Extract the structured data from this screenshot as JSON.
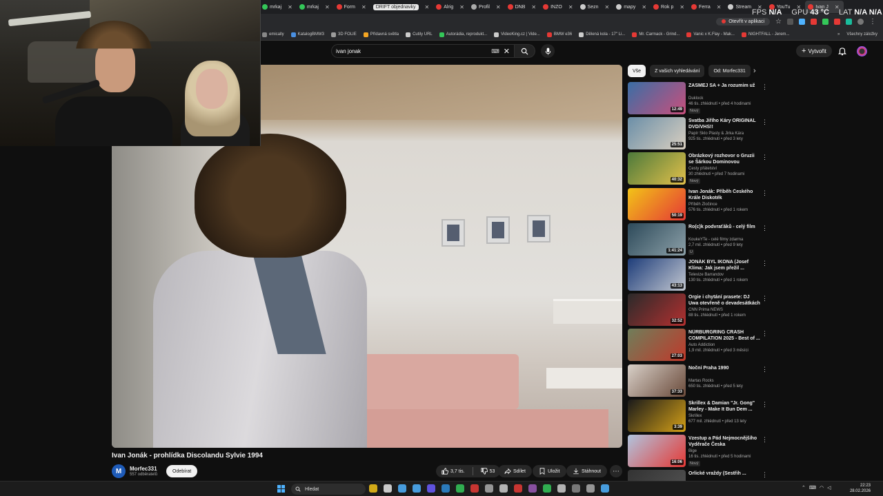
{
  "browser": {
    "tabs": [
      {
        "label": "mrkaj",
        "color": "#34c759"
      },
      {
        "label": "mrkaj",
        "color": "#34c759"
      },
      {
        "label": "Form",
        "color": "#e53935"
      },
      {
        "label": "DRIFT objednavky",
        "color": "#ffffff",
        "pill": true
      },
      {
        "label": "Alrig",
        "color": "#e53935"
      },
      {
        "label": "Profil",
        "color": "#aaaaaa"
      },
      {
        "label": "DNB",
        "color": "#e53935"
      },
      {
        "label": "INZO",
        "color": "#e53935"
      },
      {
        "label": "Sezn",
        "color": "#cccccc"
      },
      {
        "label": "mapy",
        "color": "#cccccc"
      },
      {
        "label": "Rok p",
        "color": "#e53935"
      },
      {
        "label": "Ferra",
        "color": "#e53935"
      },
      {
        "label": "Stream",
        "color": "#cccccc"
      },
      {
        "label": "YouTu",
        "color": "#e53935"
      },
      {
        "label": "Ivan J",
        "color": "#e53935",
        "active": true
      }
    ],
    "open_in_app": "Otevřít v aplikaci",
    "bookmarks": [
      {
        "label": "emically",
        "color": "#888888"
      },
      {
        "label": "KatalogBMW3",
        "color": "#4a90e2"
      },
      {
        "label": "3D FOLIE",
        "color": "#9c9c9c"
      },
      {
        "label": "Přídavná světla",
        "color": "#f5a623"
      },
      {
        "label": "Cutily URL",
        "color": "#cccccc"
      },
      {
        "label": "Autorádia, reprodukt...",
        "color": "#34c759"
      },
      {
        "label": "VideoKing.cz | Vide...",
        "color": "#cccccc"
      },
      {
        "label": "BMW e36",
        "color": "#e53935"
      },
      {
        "label": "Dělená kola - 17\" Li...",
        "color": "#cccccc"
      },
      {
        "label": "Mr. Carmack - Grind...",
        "color": "#e53935"
      },
      {
        "label": "Vanic x K.Flay - Mak...",
        "color": "#e53935"
      },
      {
        "label": "NIGHTFALL - Jerem...",
        "color": "#e53935"
      }
    ],
    "all_bookmarks": "Všechny záložky"
  },
  "hud": {
    "fps_label": "FPS",
    "fps_value": "N/A",
    "gpu_label": "GPU",
    "gpu_value": "43 °C",
    "lat_label": "LAT",
    "lat_value": "N/A N/A"
  },
  "youtube": {
    "search_value": "ivan jonak",
    "create_label": "Vytvořit",
    "video_title": "Ivan Jonák - prohlídka Discolandu Sylvie 1994",
    "channel": {
      "initial": "M",
      "name": "Morfec331",
      "subs": "557 odběratelů",
      "subscribe_label": "Odebírat"
    },
    "actions": {
      "likes": "3,7 tis.",
      "dislikes": "53",
      "share": "Sdílet",
      "save": "Uložit",
      "download": "Stáhnout"
    },
    "chips": [
      "Vše",
      "Z vašich vyhledávání",
      "Od: Morfec331"
    ],
    "recommendations": [
      {
        "title": "ZASMEJ SA + Ja rozumim už",
        "channel": "Duklock",
        "meta": "46 tis. zhlédnutí • před 4 hodinami",
        "badge": "Nový",
        "duration": "12:49",
        "c1": "#3a6ea5",
        "c2": "#c94f7c"
      },
      {
        "title": "Svatba Jiřího Káry ORIGINAL DVD/VHS!!",
        "channel": "Papír Sklo Plasty & Jirka Kára",
        "meta": "925 tis. zhlédnutí • před 3 lety",
        "badge": "",
        "duration": "25:51",
        "c1": "#6b8fa8",
        "c2": "#d9cfc0"
      },
      {
        "title": "Obrázkový rozhovor o Gruzii se Šárkou Dominovou",
        "channel": "Cesty přátelství",
        "meta": "30 zhlédnutí • před 7 hodinami",
        "badge": "Nový",
        "duration": "40:32",
        "c1": "#4d7a3b",
        "c2": "#e2c04a"
      },
      {
        "title": "Ivan Jonák: Příběh Českého Krále Diskoték",
        "channel": "Příběh Zločince",
        "meta": "576 tis. zhlédnutí • před 1 rokem",
        "badge": "",
        "duration": "50:19",
        "c1": "#f2c318",
        "c2": "#e53935"
      },
      {
        "title": "Ro(c)k podvraťáků - celý film",
        "channel": "KoukeYTe - celé filmy zdarma",
        "meta": "2,7 mil. zhlédnutí • před 9 lety",
        "badge": "U",
        "duration": "1:41:24",
        "c1": "#2d4a5a",
        "c2": "#8ca0a8"
      },
      {
        "title": "JONÁK BYL IKONA (Josef Klíma: Jak jsem přežil ...",
        "channel": "Televize Barrandov",
        "meta": "130 tis. zhlédnutí • před 1 rokem",
        "badge": "",
        "duration": "43:13",
        "c1": "#1e3d7a",
        "c2": "#c2c7d0"
      },
      {
        "title": "Orgie i chytání prasete: DJ Uwa otevřeně o devadesátkách v ...",
        "channel": "CNN Prima NEWS",
        "meta": "88 tis. zhlédnutí • před 1 rokem",
        "badge": "",
        "duration": "32:52",
        "c1": "#2a2a2a",
        "c2": "#b33030"
      },
      {
        "title": "NÜRBURGRING CRASH COMPILATION 2025 - Best of ...",
        "channel": "Auto Addiction",
        "meta": "1,9 mil. zhlédnutí • před 3 měsíci",
        "badge": "",
        "duration": "27:03",
        "c1": "#6f7e5a",
        "c2": "#c0392b"
      },
      {
        "title": "Noční Praha 1990",
        "channel": "Martas Rocks",
        "meta": "650 tis. zhlédnutí • před 5 lety",
        "badge": "",
        "duration": "37:33",
        "c1": "#d8d0c8",
        "c2": "#6a4a3a"
      },
      {
        "title": "Skrillex & Damian \"Jr. Gong\" Marley - Make It Bun Dem ...",
        "channel": "Skrillex",
        "meta": "677 mil. zhlédnutí • před 13 lety",
        "badge": "",
        "duration": "3:39",
        "c1": "#1a1a1a",
        "c2": "#d4a017"
      },
      {
        "title": "Vzestup a Pád Nejmocnějšího Vyděrače Česka",
        "channel": "Bige",
        "meta": "16 tis. zhlédnutí • před 5 hodinami",
        "badge": "Nový",
        "duration": "16:06",
        "c1": "#b0c4de",
        "c2": "#e53935"
      },
      {
        "title": "Orlické vraždy (Sestřih ...",
        "channel": "",
        "meta": "",
        "badge": "",
        "duration": "",
        "c1": "#333333",
        "c2": "#555555"
      }
    ]
  },
  "taskbar": {
    "search_label": "Hledat",
    "time": "22:23",
    "date": "28.02.2026",
    "apps": [
      "#f2c318",
      "#e8e8e8",
      "#4fb3ff",
      "#4fb3ff",
      "#6b5cff",
      "#2e8bd6",
      "#34c759",
      "#e53935",
      "#aaaaaa",
      "#cccccc",
      "#e53935",
      "#9b59b6",
      "#34c759",
      "#cccccc",
      "#888888",
      "#aaaaaa",
      "#4fb3ff"
    ]
  }
}
